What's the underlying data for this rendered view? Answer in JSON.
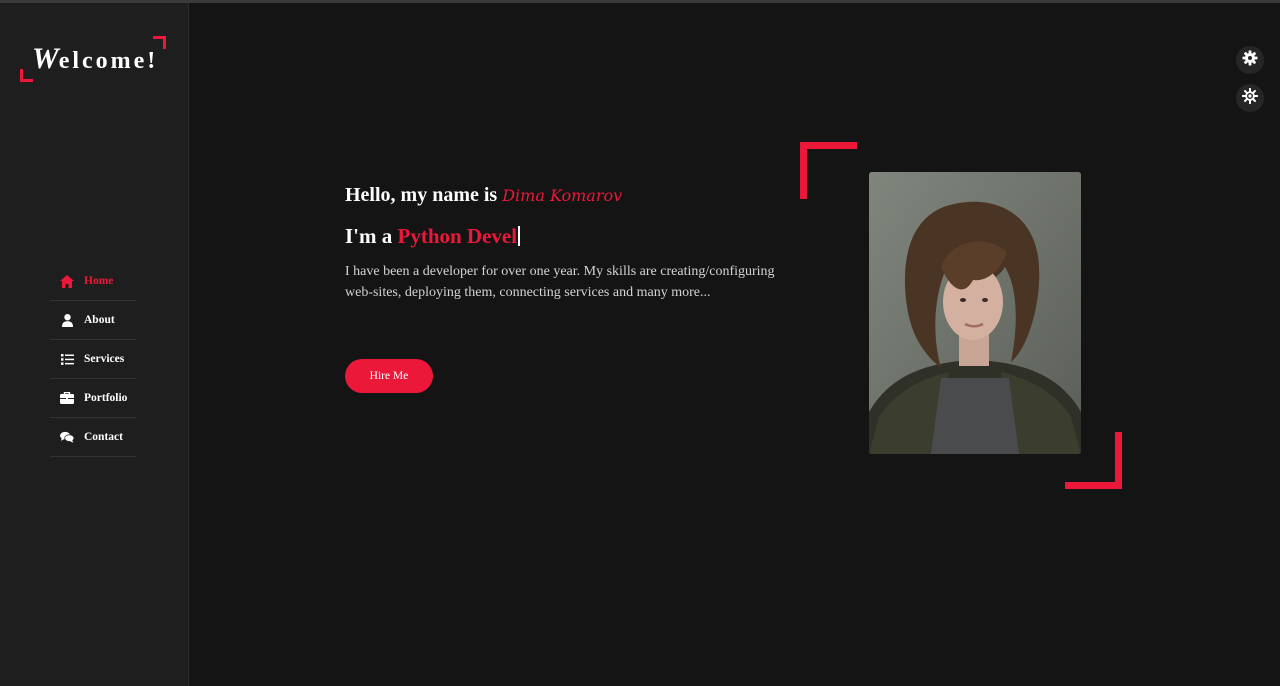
{
  "sidebar": {
    "logo_text": "Welcome!",
    "logo_first": "W",
    "logo_rest": "elcome!",
    "items": [
      {
        "label": "Home",
        "icon": "home-icon",
        "active": true
      },
      {
        "label": "About",
        "icon": "user-icon",
        "active": false
      },
      {
        "label": "Services",
        "icon": "list-icon",
        "active": false
      },
      {
        "label": "Portfolio",
        "icon": "briefcase-icon",
        "active": false
      },
      {
        "label": "Contact",
        "icon": "comments-icon",
        "active": false
      }
    ]
  },
  "tools": {
    "settings_icon": "gear-icon",
    "theme_icon": "sun-gear-icon"
  },
  "hero": {
    "greeting_prefix": "Hello, my name is",
    "name": "Dima Komarov",
    "role_prefix": "I'm a",
    "role_typed": "Python Devel",
    "description": "I have been a developer for over one year. My skills are creating/configuring web-sites, deploying them, connecting services and many more...",
    "hire_button": "Hire Me"
  },
  "colors": {
    "accent": "#ec1839",
    "background": "#141414",
    "sidebar_bg": "#1e1e1e"
  }
}
